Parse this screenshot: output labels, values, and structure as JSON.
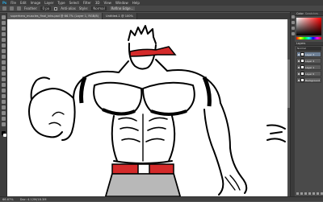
{
  "app": {
    "name": "Photoshop"
  },
  "menu": [
    "File",
    "Edit",
    "Image",
    "Layer",
    "Type",
    "Select",
    "Filter",
    "3D",
    "View",
    "Window",
    "Help"
  ],
  "options": {
    "feather_label": "Feather:",
    "feather_value": "0 px",
    "anti_alias": "Anti-alias",
    "style_label": "Style:",
    "style_value": "Normal",
    "refine_label": "Refine Edge..."
  },
  "tabs": [
    {
      "label": "superhero_muscles_final_inks.psd @ 66.7% (Layer 1, RGB/8)"
    },
    {
      "label": "Untitled-1 @ 100%"
    }
  ],
  "status": {
    "zoom": "66.67%",
    "doc": "Doc: 4.12M/18.3M"
  },
  "panels": {
    "color_tab": "Color",
    "swatches_tab": "Swatches",
    "layers_tab": "Layers",
    "blend_mode": "Normal"
  },
  "layers": [
    {
      "name": "Layer 3"
    },
    {
      "name": "Layer 2"
    },
    {
      "name": "Layer 1"
    },
    {
      "name": "Layer 0"
    },
    {
      "name": "Background"
    }
  ],
  "colors": {
    "accent": "#d42a2a",
    "canvas": "#ffffff",
    "ink": "#000000"
  }
}
